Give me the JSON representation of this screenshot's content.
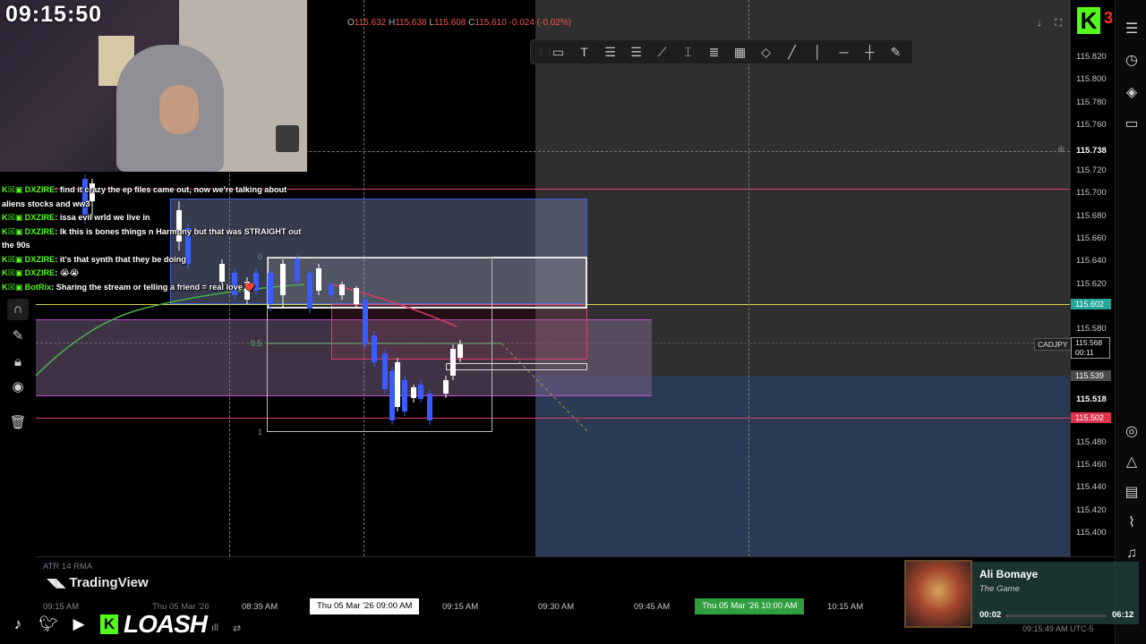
{
  "stream": {
    "clock": "09:15:50",
    "kick_count": "3",
    "brand_name": "LOASH",
    "chat": [
      {
        "user": "DXZIRE",
        "text": ": find it crazy the ep files came out, now we're talking about aliens stocks and ww3"
      },
      {
        "user": "DXZIRE",
        "text": ": issa evil wrld we live in"
      },
      {
        "user": "DXZIRE",
        "text": ": Ik this is bones things n Harmony but that was STRAIGHT out the 90s"
      },
      {
        "user": "DXZIRE",
        "text": ": it's that synth that they be doing"
      },
      {
        "user": "DXZIRE",
        "text": ": 😭😭"
      },
      {
        "user": "BotRix",
        "text": ": Sharing the stream or telling a friend = real love ❤️"
      }
    ],
    "now_playing": {
      "title": "Ali Bomaye",
      "artist": "The Game",
      "elapsed": "00:02",
      "duration": "06:12",
      "progress": 0.01
    }
  },
  "chart": {
    "ohlc": {
      "o_label": "O",
      "o": "115.632",
      "h_label": "H",
      "h": "115.638",
      "l_label": "L",
      "l": "115.608",
      "c_label": "C",
      "c": "115.610",
      "change": "-0.024 (-0.02%)"
    },
    "symbol": "CADJPY",
    "live_price": "115.568",
    "countdown": "00:11",
    "price_labels": [
      "115.820",
      "115.800",
      "115.780",
      "115.760",
      "115.738",
      "115.720",
      "115.700",
      "115.680",
      "115.660",
      "115.640",
      "115.620",
      "115.580",
      "115.539",
      "115.518",
      "115.480",
      "115.460",
      "115.440",
      "115.420",
      "115.400"
    ],
    "price_tags": {
      "current": "115.602",
      "lower_red": "115.502",
      "mid": "115.539"
    },
    "fib_levels": {
      "top": "0",
      "mid": "0.5",
      "bottom": "1"
    },
    "indicator": "ATR 14 RMA",
    "logo": "TradingView",
    "time_labels": [
      "09:15 AM",
      "08:39 AM",
      "09:15 AM",
      "09:30 AM",
      "09:45 AM",
      "10:15 AM"
    ],
    "time_highlight_1": "Thu 05 Mar '26  09:00 AM",
    "time_highlight_2": "Thu 05 Mar '26  10:00 AM",
    "time_partial": "Thu 05 Mar '26",
    "utc": "09:15:49 AM UTC-5",
    "colors": {
      "up_candle": "#ffffff",
      "down_candle": "#3a5cff",
      "current_price_tag": "#26a69a",
      "red_tag": "#e0334e",
      "accent_green": "#53fc18"
    }
  }
}
